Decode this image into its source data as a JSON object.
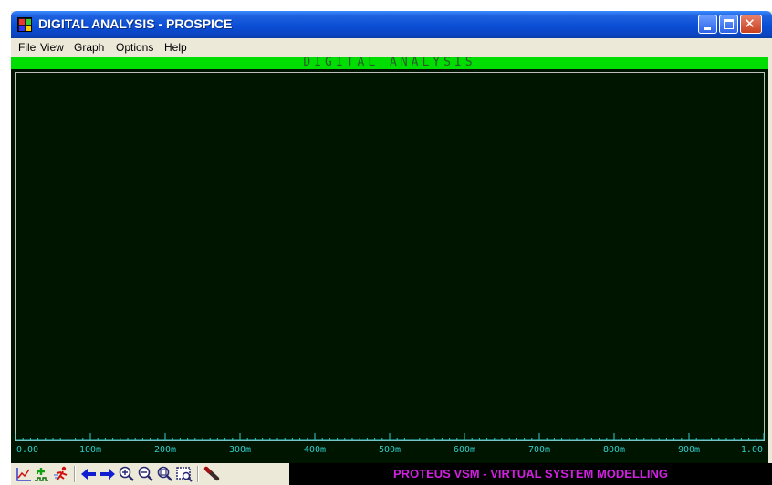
{
  "window": {
    "title": "DIGITAL ANALYSIS - PROSPICE",
    "title_bar_color": "#0a4ed6",
    "controls": [
      {
        "name": "minimize-icon"
      },
      {
        "name": "maximize-icon"
      },
      {
        "name": "close-icon",
        "glyph": "✕"
      }
    ]
  },
  "menu": [
    "File",
    "View",
    "Graph",
    "Options",
    "Help"
  ],
  "graph": {
    "title": "DIGITAL ANALYSIS",
    "header_color": "#00dd00",
    "background_color": "#001500",
    "axis_color": "#33cccc",
    "x_ticks": [
      "0.00",
      "100m",
      "200m",
      "300m",
      "400m",
      "500m",
      "600m",
      "700m",
      "800m",
      "900m",
      "1.00"
    ]
  },
  "toolbar": {
    "tools": [
      "graph-simulate-icon",
      "add-trace-icon",
      "run-icon",
      "pan-left-icon",
      "pan-right-icon",
      "zoom-in-icon",
      "zoom-out-icon",
      "zoom-all-icon",
      "zoom-area-icon",
      "probe-icon"
    ]
  },
  "status": {
    "text": "PROTEUS VSM - VIRTUAL SYSTEM MODELLING",
    "color": "#d020e0"
  }
}
